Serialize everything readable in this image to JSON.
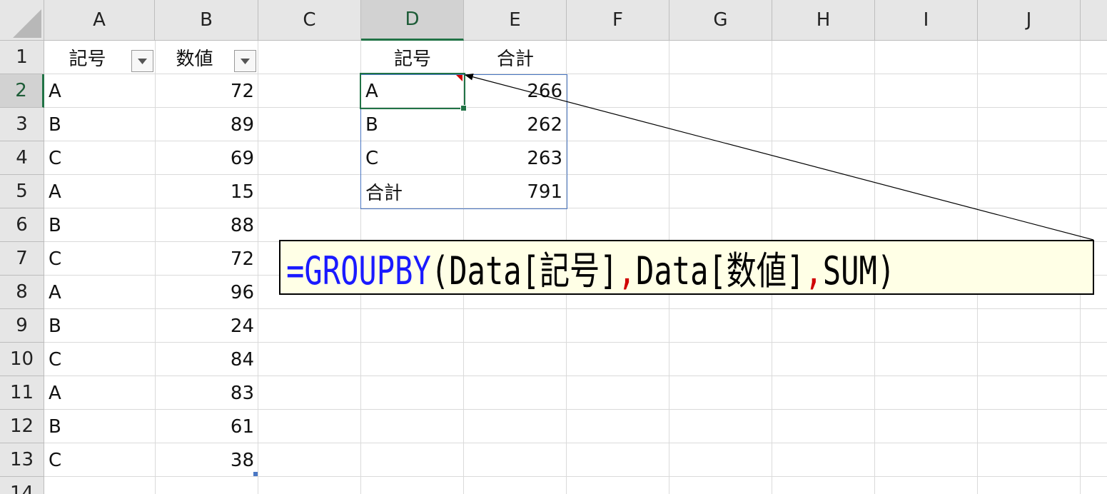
{
  "columns": [
    "A",
    "B",
    "C",
    "D",
    "E",
    "F",
    "G",
    "H",
    "I",
    "J"
  ],
  "rows": [
    "1",
    "2",
    "3",
    "4",
    "5",
    "6",
    "7",
    "8",
    "9",
    "10",
    "11",
    "12",
    "13",
    "14"
  ],
  "table": {
    "headers": [
      "記号",
      "数値"
    ],
    "rows": [
      [
        "A",
        "72"
      ],
      [
        "B",
        "89"
      ],
      [
        "C",
        "69"
      ],
      [
        "A",
        "15"
      ],
      [
        "B",
        "88"
      ],
      [
        "C",
        "72"
      ],
      [
        "A",
        "96"
      ],
      [
        "B",
        "24"
      ],
      [
        "C",
        "84"
      ],
      [
        "A",
        "83"
      ],
      [
        "B",
        "61"
      ],
      [
        "C",
        "38"
      ]
    ]
  },
  "result": {
    "headers": [
      "記号",
      "合計"
    ],
    "rows": [
      [
        "A",
        "266"
      ],
      [
        "B",
        "262"
      ],
      [
        "C",
        "263"
      ],
      [
        "合計",
        "791"
      ]
    ]
  },
  "formula": {
    "equals": "=",
    "function": "GROUPBY",
    "open": "(",
    "arg1": "Data[記号]",
    "sep1": ",",
    "arg2": "Data[数値]",
    "sep2": ",",
    "arg3": "SUM",
    "close": ")"
  },
  "colors": {
    "selection": "#217346",
    "table_border": "#4a77c4",
    "function_color": "#1a1aff",
    "separator_color": "#d00000",
    "callout_bg": "#ffffe6"
  }
}
